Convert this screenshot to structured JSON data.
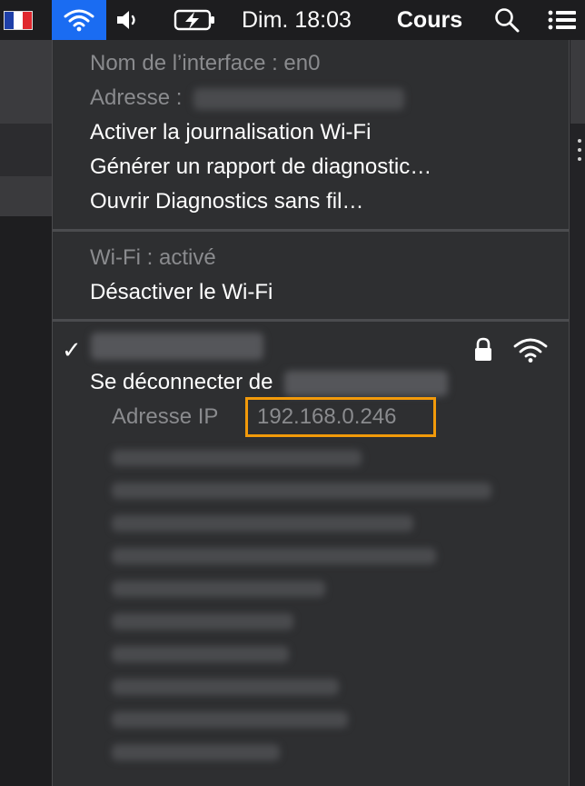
{
  "menubar": {
    "clock": "Dim. 18:03",
    "account": "Cours",
    "icons": [
      "flag-fr-icon",
      "wifi-icon",
      "volume-icon",
      "battery-charging-icon",
      "search-icon",
      "list-icon"
    ]
  },
  "menu": {
    "interface_name": "Nom de l’interface : en0",
    "address_label": "Adresse :",
    "enable_logging": "Activer la journalisation Wi-Fi",
    "generate_report": "Générer un rapport de diagnostic…",
    "open_diagnostics": "Ouvrir Diagnostics sans fil…",
    "wifi_status": "Wi-Fi : activé",
    "disable_wifi": "Désactiver le Wi-Fi",
    "disconnect_prefix": "Se déconnecter de",
    "ip_label": "Adresse IP",
    "ip_value": "192.168.0.246"
  },
  "colors": {
    "menubar_bg": "#1d1d1f",
    "wifi_highlight": "#1a6cf2",
    "menu_bg": "#2e2f31",
    "text_primary": "#ffffff",
    "text_disabled": "#8a8b8e",
    "ip_highlight_border": "#f29a0a"
  }
}
